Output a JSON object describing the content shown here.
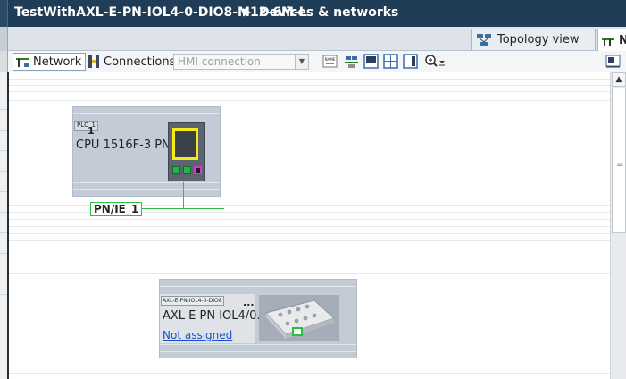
{
  "header": {
    "project": "TestWithAXL-E-PN-IOL4-0-DIO8-M12-6M-L",
    "separator": "▶",
    "view": "Devices & networks"
  },
  "view_tabs": {
    "topology_label": "Topology view",
    "network_label": "N"
  },
  "toolbar": {
    "network_label": "Network",
    "connections_label": "Connections",
    "hmi_select_value": "HMI connection",
    "name_icon_text": "NAME"
  },
  "canvas": {
    "plc": {
      "tag": "PLC_1",
      "tag_suffix": "1",
      "description": "CPU 1516F-3 PN..."
    },
    "subnet": {
      "label": "PN/IE_1"
    },
    "io_device": {
      "tag": "AXL-E-PN-IOL4-0-DIO8",
      "tag_ellipsis": "...",
      "description": "AXL E PN IOL4/0...",
      "assignment": "Not assigned"
    }
  },
  "colors": {
    "title_bg": "#1f3d57",
    "device_bg": "#c3ccd6",
    "link_green": "#2fbf3b",
    "plc_screen_yellow": "#f2ea1a",
    "port_magenta": "#c93bd2",
    "hyperlink_blue": "#1a4fd1"
  }
}
